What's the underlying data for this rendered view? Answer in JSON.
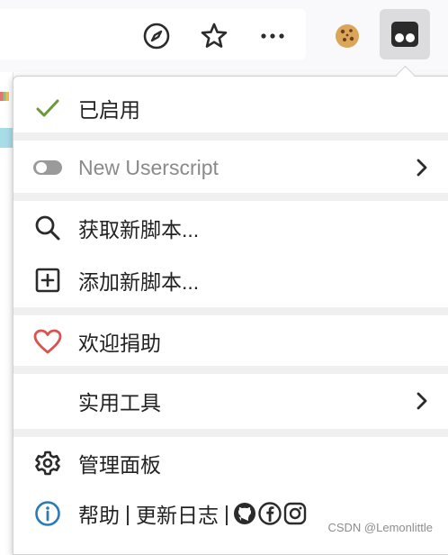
{
  "toolbar": {
    "icons": [
      "compass-icon",
      "star-icon",
      "more-icon",
      "cookie-icon",
      "tampermonkey-icon"
    ]
  },
  "menu": {
    "enabled_label": "已启用",
    "script_name": "New Userscript",
    "get_scripts": "获取新脚本...",
    "add_script": "添加新脚本...",
    "donate": "欢迎捐助",
    "utilities": "实用工具",
    "dashboard": "管理面板",
    "help": "帮助",
    "separator": "|",
    "changelog": "更新日志",
    "separator2": "|"
  },
  "watermark": "CSDN @Lemonlittle",
  "colors": {
    "check": "#6a9a3a",
    "heart": "#d9534f",
    "info": "#2a7ab8",
    "separator": "#f0f0f0"
  }
}
